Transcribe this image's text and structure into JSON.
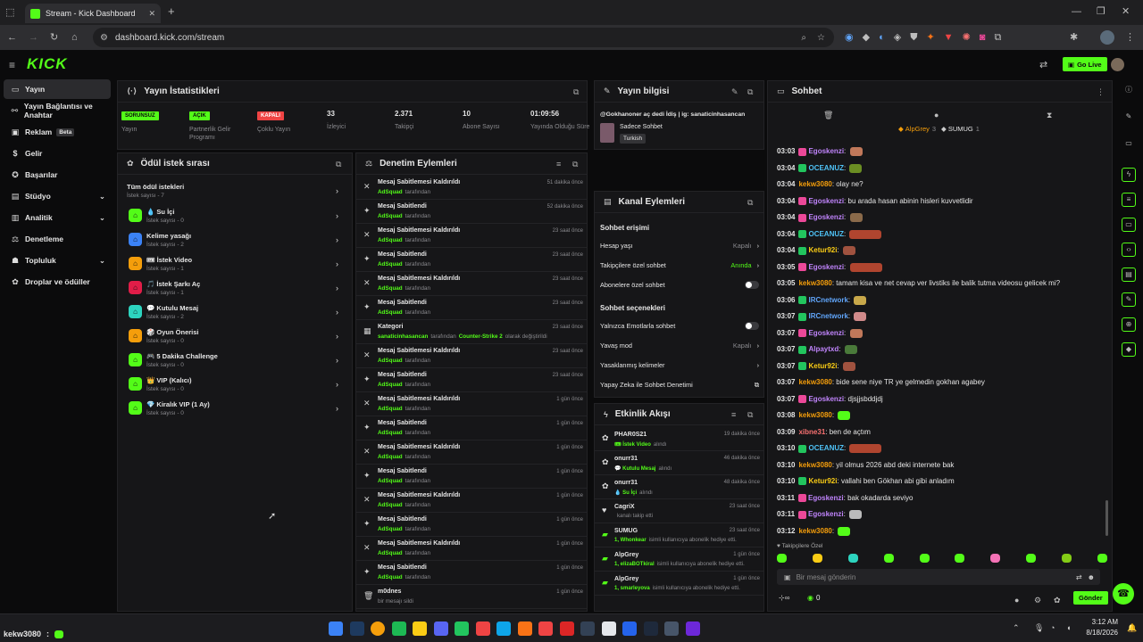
{
  "browser": {
    "tab_title": "Stream - Kick Dashboard",
    "url": "dashboard.kick.com/stream"
  },
  "app": {
    "logo": "KICK",
    "go_live": "Go Live"
  },
  "sidebar": {
    "items": [
      {
        "label": "Yayın",
        "icon": "video-icon"
      },
      {
        "label": "Yayın Bağlantısı ve Anahtar",
        "icon": "link-icon"
      },
      {
        "label": "Reklam",
        "icon": "ad-icon",
        "badge": "Beta"
      },
      {
        "label": "Gelir",
        "icon": "money-icon"
      },
      {
        "label": "Başarılar",
        "icon": "trophy-icon"
      },
      {
        "label": "Stüdyo",
        "icon": "studio-icon"
      },
      {
        "label": "Analitik",
        "icon": "chart-icon"
      },
      {
        "label": "Denetleme",
        "icon": "hammer-icon"
      },
      {
        "label": "Topluluk",
        "icon": "users-icon"
      },
      {
        "label": "Droplar ve ödüller",
        "icon": "gift-icon"
      }
    ]
  },
  "stats": {
    "title": "Yayın İstatistikleri",
    "items": [
      {
        "badge": "SORUNSUZ",
        "label": "Yayın"
      },
      {
        "badge": "AÇIK",
        "label": "Partnerlik Gelir Programı"
      },
      {
        "badge": "KAPALI",
        "label": "Çoklu Yayın"
      },
      {
        "value": "33",
        "label": "İzleyici"
      },
      {
        "value": "2.371",
        "label": "Takipçi"
      },
      {
        "value": "10",
        "label": "Abone Sayısı"
      },
      {
        "value": "01:09:56",
        "label": "Yayında Olduğu Süre"
      }
    ]
  },
  "rewards": {
    "title": "Ödül istek sırası",
    "items": [
      {
        "name": "Tüm ödül istekleri",
        "sub": "İstek sayısı - 7"
      },
      {
        "name": "💧 Su İçi",
        "sub": "İstek sayısı - 0"
      },
      {
        "name": "Kelime yasağı",
        "sub": "İstek sayısı - 2"
      },
      {
        "name": "🎟 İstek Video",
        "sub": "İstek sayısı - 1"
      },
      {
        "name": "🎵 İstek Şarkı Aç",
        "sub": "İstek sayısı - 1"
      },
      {
        "name": "💬 Kutulu Mesaj",
        "sub": "İstek sayısı - 2"
      },
      {
        "name": "🎲 Oyun Önerisi",
        "sub": "İstek sayısı - 0"
      },
      {
        "name": "🎮 5 Dakika Challenge",
        "sub": "İstek sayısı - 0"
      },
      {
        "name": "👑 VIP (Kalıcı)",
        "sub": "İstek sayısı - 0"
      },
      {
        "name": "💎 Kiralık VIP (1 Ay)",
        "sub": "İstek sayısı - 0"
      }
    ]
  },
  "moderation": {
    "title": "Denetim Eylemleri",
    "by": "tarafından",
    "items": [
      {
        "t": "Mesaj Sabitlemesi Kaldırıldı",
        "u": "AdSquad",
        "time": "51 dakika önce"
      },
      {
        "t": "Mesaj Sabitlendi",
        "u": "AdSquad",
        "time": "52 dakika önce"
      },
      {
        "t": "Mesaj Sabitlemesi Kaldırıldı",
        "u": "AdSquad",
        "time": "23 saat önce"
      },
      {
        "t": "Mesaj Sabitlendi",
        "u": "AdSquad",
        "time": "23 saat önce"
      },
      {
        "t": "Mesaj Sabitlemesi Kaldırıldı",
        "u": "AdSquad",
        "time": "23 saat önce"
      },
      {
        "t": "Mesaj Sabitlendi",
        "u": "AdSquad",
        "time": "23 saat önce"
      },
      {
        "t": "Kategori",
        "u": "sanaticinhasancan",
        "extra": "Counter-Strike 2",
        "extra_text": "olarak değiştirildi",
        "time": "23 saat önce"
      },
      {
        "t": "Mesaj Sabitlemesi Kaldırıldı",
        "u": "AdSquad",
        "time": "23 saat önce"
      },
      {
        "t": "Mesaj Sabitlendi",
        "u": "AdSquad",
        "time": "23 saat önce"
      },
      {
        "t": "Mesaj Sabitlemesi Kaldırıldı",
        "u": "AdSquad",
        "time": "1 gün önce"
      },
      {
        "t": "Mesaj Sabitlendi",
        "u": "AdSquad",
        "time": "1 gün önce"
      },
      {
        "t": "Mesaj Sabitlemesi Kaldırıldı",
        "u": "AdSquad",
        "time": "1 gün önce"
      },
      {
        "t": "Mesaj Sabitlendi",
        "u": "AdSquad",
        "time": "1 gün önce"
      },
      {
        "t": "Mesaj Sabitlemesi Kaldırıldı",
        "u": "AdSquad",
        "time": "1 gün önce"
      },
      {
        "t": "Mesaj Sabitlendi",
        "u": "AdSquad",
        "time": "1 gün önce"
      },
      {
        "t": "Mesaj Sabitlemesi Kaldırıldı",
        "u": "AdSquad",
        "time": "1 gün önce"
      },
      {
        "t": "Mesaj Sabitlendi",
        "u": "AdSquad",
        "time": "1 gün önce"
      },
      {
        "t": "m0dnes",
        "u": "",
        "sub": "bir mesajı sildi",
        "time": "1 gün önce"
      }
    ]
  },
  "stream_info": {
    "title": "Yayın bilgisi",
    "stream_title": "@Gokhanoner aç dedi İdiş | ig: sanaticinhasancan",
    "category": "Sadece Sohbet",
    "tag": "Turkish"
  },
  "channel": {
    "title": "Kanal Eylemleri",
    "section1": "Sohbet erişimi",
    "rows1": [
      {
        "label": "Hesap yaşı",
        "value": "Kapalı"
      },
      {
        "label": "Takipçilere özel sohbet",
        "value": "Anında"
      },
      {
        "label": "Abonelere özel sohbet",
        "value": ""
      }
    ],
    "section2": "Sohbet seçenekleri",
    "rows2": [
      {
        "label": "Yalnızca Emotlarla sohbet",
        "value": ""
      },
      {
        "label": "Yavaş mod",
        "value": "Kapalı"
      },
      {
        "label": "Yasaklanmış kelimeler",
        "value": ""
      },
      {
        "label": "Yapay Zeka ile Sohbet Denetimi",
        "value": ""
      }
    ]
  },
  "activity": {
    "title": "Etkinlik Akışı",
    "items": [
      {
        "u": "PHAR0S21",
        "d": "🎟 İstek Video",
        "d2": "alındı",
        "time": "19 dakika önce"
      },
      {
        "u": "onurr31",
        "d": "💬 Kutulu Mesaj",
        "d2": "alındı",
        "time": "46 dakika önce"
      },
      {
        "u": "onurr31",
        "d": "💧 Su İçi",
        "d2": "alındı",
        "time": "48 dakika önce"
      },
      {
        "u": "CagriX",
        "d": "",
        "d2": "kanalı takip etti",
        "time": "23 saat önce"
      },
      {
        "u": "SUMUG",
        "d": "1, Whonkear",
        "d2": "isimli kullanıcıya abonelik hediye etti.",
        "time": "23 saat önce"
      },
      {
        "u": "AlpGrey",
        "d": "1, elizaBOTkiral",
        "d2": "isimli kullanıcıya abonelik hediye etti.",
        "time": "1 gün önce"
      },
      {
        "u": "AlpGrey",
        "d": "1, smarleyova",
        "d2": "isimli kullanıcıya abonelik hediye etti.",
        "time": "1 gün önce"
      }
    ]
  },
  "chat": {
    "title": "Sohbet",
    "top_gifters": [
      "AlpGrey",
      "3",
      "SUMUG",
      "1"
    ],
    "followers_only": "Takipçilere Özel",
    "placeholder": "Bir mesaj gönderin",
    "send": "Gönder",
    "count": "0",
    "messages": [
      {
        "time": "03:03",
        "user": "Egoskenzi",
        "color": "#c084fc",
        "msg": "",
        "emote": "#c0785a"
      },
      {
        "time": "03:04",
        "user": "OCEANUZ",
        "color": "#4fc3f7",
        "msg": "",
        "emote": "#6b8e23"
      },
      {
        "time": "03:04",
        "user": "kekw3080",
        "color": "#f59e0b",
        "msg": "olay ne?"
      },
      {
        "time": "03:04",
        "user": "Egoskenzi",
        "color": "#c084fc",
        "msg": "bu arada hasan abinin hisleri kuvvetlidir"
      },
      {
        "time": "03:04",
        "user": "Egoskenzi",
        "color": "#c084fc",
        "msg": "",
        "emote": "#8a6a4a"
      },
      {
        "time": "03:04",
        "user": "OCEANUZ",
        "color": "#4fc3f7",
        "msg": "",
        "emote": "#b0452f"
      },
      {
        "time": "03:04",
        "user": "Ketur92i",
        "color": "#facc15",
        "msg": "",
        "emote": "#a0523f"
      },
      {
        "time": "03:05",
        "user": "Egoskenzi",
        "color": "#c084fc",
        "msg": "",
        "emote": "#b0452f"
      },
      {
        "time": "03:05",
        "user": "kekw3080",
        "color": "#f59e0b",
        "msg": "tamam kisa ve net cevap ver livstiks ile balik tutma videosu gelicek mi?"
      },
      {
        "time": "03:06",
        "user": "IRCnetwork",
        "color": "#60a5fa",
        "msg": "",
        "emote": "#c8a84a"
      },
      {
        "time": "03:07",
        "user": "IRCnetwork",
        "color": "#60a5fa",
        "msg": "",
        "emote": "#d08a8a"
      },
      {
        "time": "03:07",
        "user": "Egoskenzi",
        "color": "#c084fc",
        "msg": "",
        "emote": "#c0785a"
      },
      {
        "time": "03:07",
        "user": "Alpaytxd",
        "color": "#c084fc",
        "msg": "",
        "emote": "#4a7a3a"
      },
      {
        "time": "03:07",
        "user": "Ketur92i",
        "color": "#facc15",
        "msg": "",
        "emote": "#a0523f"
      },
      {
        "time": "03:07",
        "user": "kekw3080",
        "color": "#f59e0b",
        "msg": "bide sene niye TR ye gelmedin gokhan agabey"
      },
      {
        "time": "03:07",
        "user": "Egoskenzi",
        "color": "#c084fc",
        "msg": "djsjjsbddjdj"
      },
      {
        "time": "03:08",
        "user": "kekw3080",
        "color": "#f59e0b",
        "msg": "",
        "emote": "#53fc18"
      },
      {
        "time": "03:09",
        "user": "xibne31",
        "color": "#f87171",
        "msg": "ben de açtım"
      },
      {
        "time": "03:10",
        "user": "OCEANUZ",
        "color": "#4fc3f7",
        "msg": "",
        "emote": "#b0452f"
      },
      {
        "time": "03:10",
        "user": "kekw3080",
        "color": "#f59e0b",
        "msg": "yil olmus 2026 abd deki internete bak"
      },
      {
        "time": "03:10",
        "user": "Ketur92i",
        "color": "#facc15",
        "msg": "vallahi ben Gökhan abi gibi anladım"
      },
      {
        "time": "03:11",
        "user": "Egoskenzi",
        "color": "#c084fc",
        "msg": "bak okadarda seviyo"
      },
      {
        "time": "03:11",
        "user": "Egoskenzi",
        "color": "#c084fc",
        "msg": "",
        "emote": "#bbbbbb"
      },
      {
        "time": "03:12",
        "user": "kekw3080",
        "color": "#f59e0b",
        "msg": "",
        "emote": "#53fc18"
      }
    ]
  },
  "overlay": {
    "user": "kekw3080"
  },
  "taskbar": {
    "time": "3:12 AM",
    "date": "8/18/2026"
  },
  "colors": {
    "accent": "#53fc18",
    "bg": "#0b0b0c",
    "panel": "#161618"
  }
}
